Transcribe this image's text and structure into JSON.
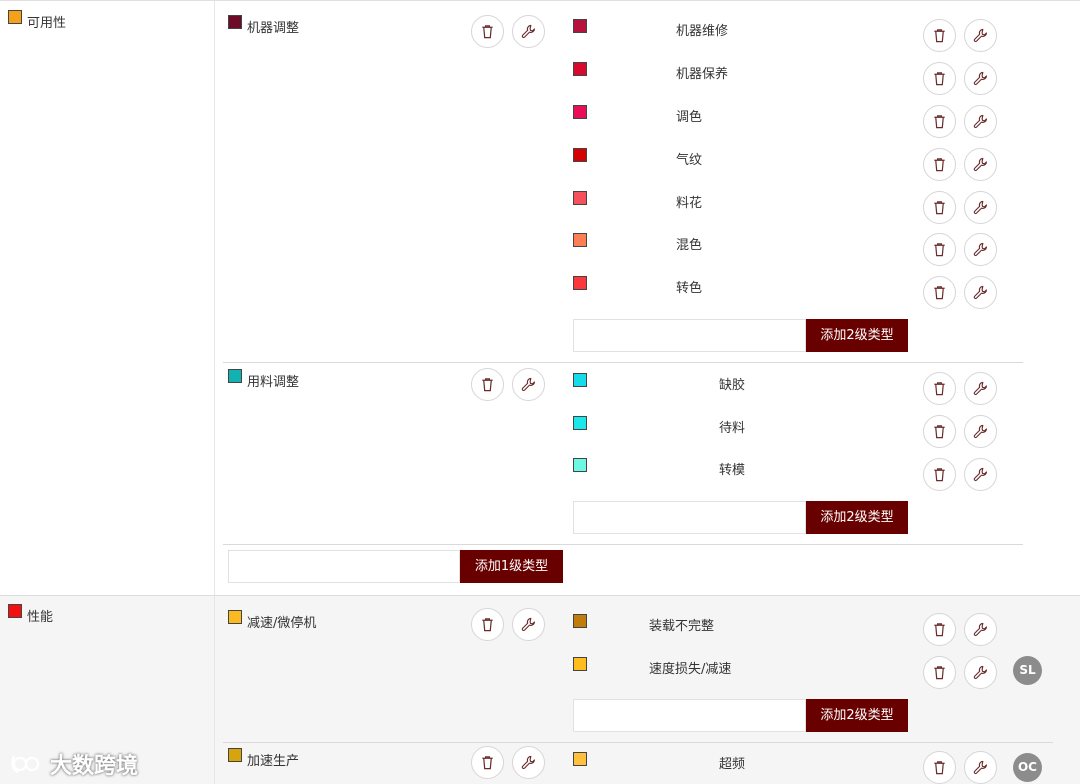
{
  "labels": {
    "add_l2": "添加2级类型",
    "add_l1": "添加1级类型"
  },
  "colors": {
    "accent_button": "#680000",
    "availability": "#f5a11c",
    "performance": "#f20f12"
  },
  "groups": [
    {
      "name": "可用性",
      "color": "#f5a11c",
      "subgroups": [
        {
          "name": "机器调整",
          "color": "#6e0b28",
          "items": [
            {
              "name": "机器维修",
              "color": "#b5123d"
            },
            {
              "name": "机器保养",
              "color": "#d9082f"
            },
            {
              "name": "调色",
              "color": "#ea0d57"
            },
            {
              "name": "气纹",
              "color": "#d20303"
            },
            {
              "name": "料花",
              "color": "#f4515c"
            },
            {
              "name": "混色",
              "color": "#fe7e56"
            },
            {
              "name": "转色",
              "color": "#fc373d"
            }
          ]
        },
        {
          "name": "用料调整",
          "color": "#13b2b2",
          "items": [
            {
              "name": "缺胶",
              "color": "#16dcea"
            },
            {
              "name": "待料",
              "color": "#1ae8ea"
            },
            {
              "name": "转模",
              "color": "#6df8e6"
            }
          ]
        }
      ]
    },
    {
      "name": "性能",
      "color": "#f20f12",
      "subgroups": [
        {
          "name": "减速/微停机",
          "color": "#fcba22",
          "items": [
            {
              "name": "装载不完整",
              "color": "#c07d0c"
            },
            {
              "name": "速度损失/减速",
              "color": "#fdbd1c"
            }
          ]
        },
        {
          "name": "加速生产",
          "color": "#d6a40d",
          "items": [
            {
              "name": "超频",
              "color": "#ffc13d"
            }
          ]
        }
      ]
    }
  ],
  "avatars": [
    "SL",
    "OC"
  ],
  "watermark": "大数跨境",
  "icons": {
    "delete": "trash-icon",
    "edit": "wrench-icon"
  }
}
